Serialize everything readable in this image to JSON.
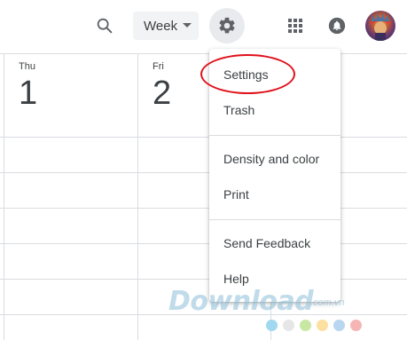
{
  "header": {
    "view_label": "Week"
  },
  "days": [
    {
      "name": "Thu",
      "number": "1"
    },
    {
      "name": "Fri",
      "number": "2"
    }
  ],
  "menu": {
    "items": [
      {
        "label": "Settings"
      },
      {
        "label": "Trash"
      },
      {
        "label": "Density and color"
      },
      {
        "label": "Print"
      },
      {
        "label": "Send Feedback"
      },
      {
        "label": "Help"
      }
    ]
  },
  "icons": {
    "search": "search-icon",
    "settings": "gear-icon",
    "apps": "apps-grid-icon",
    "notifications": "bell-icon"
  },
  "colors": {
    "highlight": "#e0111b",
    "gear_button_bg": "#e8eaed",
    "grid_line": "#dadce0"
  },
  "watermark": {
    "brand": "Download",
    "domain": ".com.vn",
    "dot_colors": [
      "#9fd8ef",
      "#e6e6e6",
      "#c9e7a4",
      "#fde0a0",
      "#b8d6ef",
      "#f6b5b5"
    ]
  }
}
